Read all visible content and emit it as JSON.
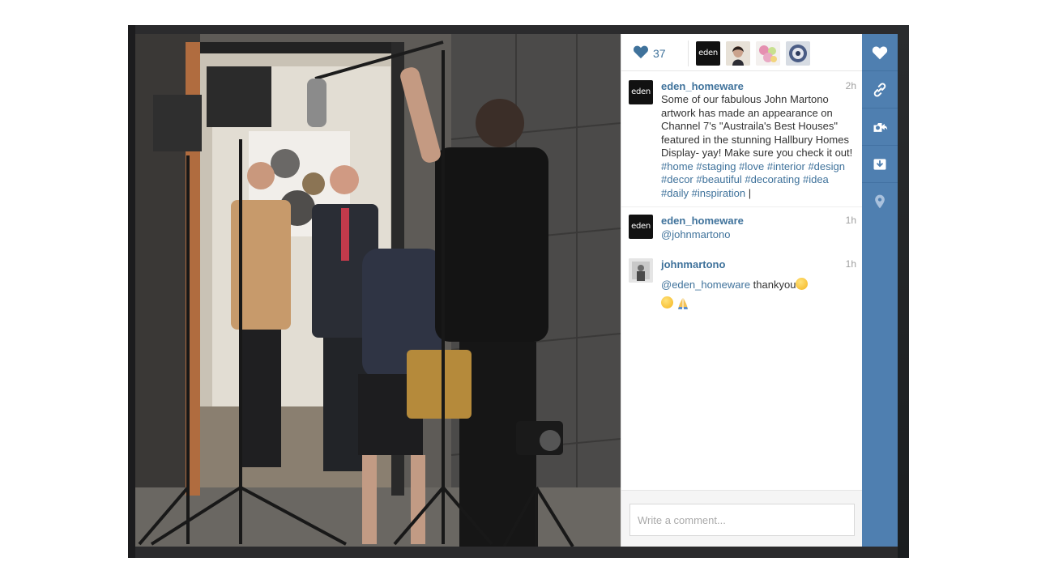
{
  "post": {
    "likes_count": "37",
    "likers": [
      "eden",
      "",
      "",
      ""
    ]
  },
  "caption": {
    "username": "eden_homeware",
    "time": "2h",
    "avatar_text": "eden",
    "text_plain": "Some of our fabulous John Martono artwork has made an appearance on Channel 7's \"Austraila's Best Houses\" featured in the stunning Hallbury Homes Display- yay! Make sure you check it out!",
    "hashtags": [
      "#home",
      "#staging",
      "#love",
      "#interior",
      "#design",
      "#decor",
      "#beautiful",
      "#decorating",
      "#idea",
      "#daily",
      "#inspiration"
    ],
    "trailing": "|"
  },
  "comments": [
    {
      "username": "eden_homeware",
      "time": "1h",
      "avatar_text": "eden",
      "mention": "@johnmartono",
      "text": ""
    },
    {
      "username": "johnmartono",
      "time": "1h",
      "avatar_text": "",
      "mention": "@eden_homeware",
      "text": "thankyou"
    }
  ],
  "comment_input": {
    "placeholder": "Write a comment..."
  },
  "rail": {
    "icons": [
      "heart-icon",
      "link-icon",
      "share-icon",
      "save-icon",
      "location-icon"
    ]
  },
  "colors": {
    "link": "#3f729b",
    "rail": "#4f7fb0"
  }
}
